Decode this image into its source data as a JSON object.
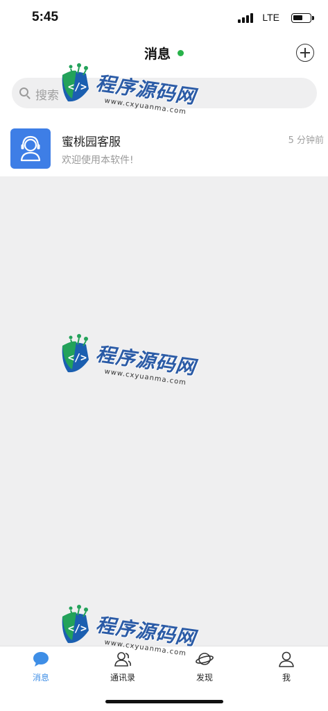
{
  "status_bar": {
    "time": "5:45",
    "network": "LTE",
    "battery_level": 0.6,
    "signal_bars": 4
  },
  "header": {
    "title": "消息",
    "online_status_color": "#28b24a",
    "add_icon": "add-circle-icon"
  },
  "search": {
    "placeholder": "搜索",
    "icon": "search-icon"
  },
  "conversations": [
    {
      "name": "蜜桃园客服",
      "preview": "欢迎使用本软件!",
      "time": "5 分钟前",
      "avatar_icon": "customer-service-icon",
      "avatar_color": "#3e7ee6"
    }
  ],
  "watermark": {
    "text": "程序源码网",
    "url": "www.cxyuanma.com"
  },
  "tab_bar": {
    "items": [
      {
        "label": "消息",
        "icon": "chat-bubble-icon",
        "active": true
      },
      {
        "label": "通讯录",
        "icon": "contacts-icon",
        "active": false
      },
      {
        "label": "发现",
        "icon": "planet-icon",
        "active": false
      },
      {
        "label": "我",
        "icon": "user-icon",
        "active": false
      }
    ],
    "active_color": "#3e8ee6"
  }
}
